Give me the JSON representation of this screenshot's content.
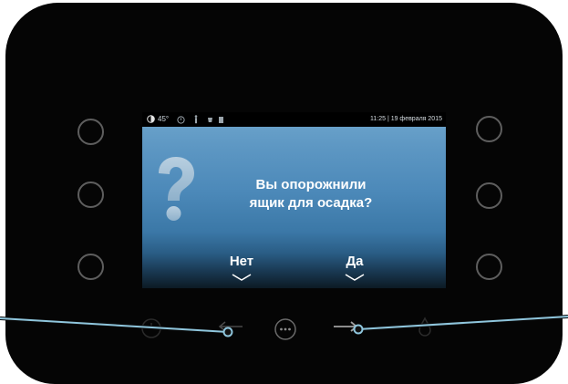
{
  "screen": {
    "status": {
      "temperature": "45°",
      "datetime": "11:25 | 19 февраля 2015"
    },
    "dialog": {
      "question_line1": "Вы опорожнили",
      "question_line2": "ящик для осадка?",
      "no_label": "Нет",
      "yes_label": "Да"
    }
  },
  "colors": {
    "device_body": "#050505",
    "button_outline": "#5e5e5e",
    "callout_blue": "#8fc6dd",
    "screen_top": "#6fa6cd",
    "screen_bottom": "#0c1a24"
  },
  "icons": {
    "status": [
      "thermometer-icon",
      "clock-icon",
      "person-icon",
      "cup-icon",
      "bin-icon"
    ],
    "bottom_bar": [
      "power-icon",
      "arrow-left-icon",
      "menu-dots-icon",
      "arrow-right-icon",
      "water-drop-icon"
    ],
    "screen": [
      "question-mark-icon",
      "chevron-down-icon"
    ]
  }
}
